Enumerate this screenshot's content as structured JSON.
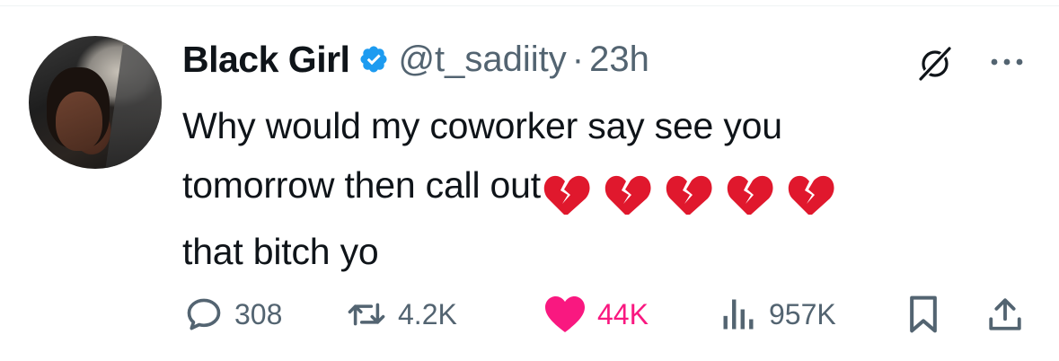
{
  "tweet": {
    "author": {
      "name": "Black Girl",
      "handle": "@t_sadiity",
      "verified": true
    },
    "separator": "·",
    "time": "23h",
    "text_line1": "Why would my coworker say see you",
    "text_line2": "tomorrow then call out",
    "text_line3": "that bitch yo",
    "emoji": [
      "broken-heart",
      "broken-heart",
      "broken-heart",
      "broken-heart",
      "broken-heart"
    ]
  },
  "actions": {
    "replies": "308",
    "retweets": "4.2K",
    "likes": "44K",
    "views": "957K"
  },
  "colors": {
    "text": "#0f1419",
    "secondary": "#536471",
    "verified": "#1d9bf0",
    "like": "#f91880",
    "broken_heart": "#e0182d"
  }
}
